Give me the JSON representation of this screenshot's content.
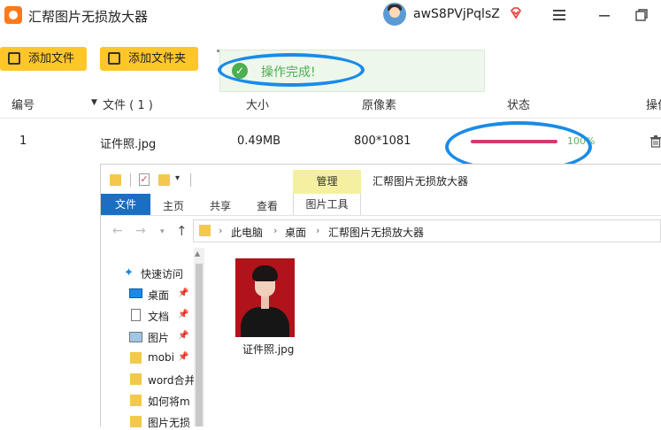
{
  "app": {
    "title": "汇帮图片无损放大器",
    "username": "awS8PVjPqlsZ",
    "window_controls": [
      "menu-icon",
      "minimize-icon",
      "maximize-icon",
      "close-icon"
    ],
    "accent_color": "#ffc62a"
  },
  "toolbar": {
    "add_file_label": "添加文件",
    "add_folder_label": "添加文件夹"
  },
  "toast": {
    "message": "操作完成!",
    "color": "#4caf50"
  },
  "table": {
    "headers": {
      "index": "编号",
      "file": "文件 ( 1 )",
      "size": "大小",
      "pixels": "原像素",
      "status": "状态",
      "action": "操作"
    },
    "rows": [
      {
        "index": "1",
        "filename": "证件照.jpg",
        "size": "0.49MB",
        "pixels": "800*1081",
        "progress": 1.0,
        "percent": "100%",
        "progress_color": "#d63a6e"
      }
    ]
  },
  "explorer": {
    "window_title": "汇帮图片无损放大器",
    "context_tab": "管理",
    "tabs": {
      "file": "文件",
      "home": "主页",
      "share": "共享",
      "view": "查看",
      "picture_tools": "图片工具"
    },
    "breadcrumb": [
      "此电脑",
      "桌面",
      "汇帮图片无损放大器"
    ],
    "nav": {
      "quick_access": "快速访问",
      "items": [
        "桌面",
        "文档",
        "图片",
        "mobi",
        "word合并",
        "如何将m",
        "图片无损"
      ]
    },
    "files": [
      {
        "name": "证件照.jpg"
      }
    ]
  }
}
